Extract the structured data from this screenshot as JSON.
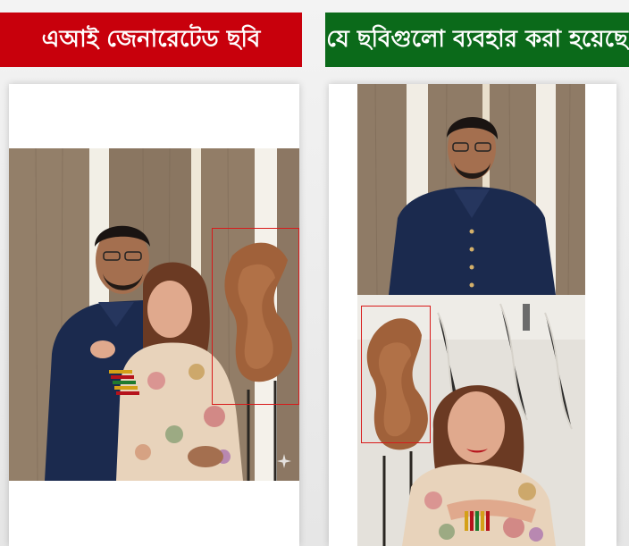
{
  "left_panel": {
    "title": "এআই জেনারেটেড ছবি",
    "title_bg": "#c8000c"
  },
  "right_panel": {
    "title": "যে ছবিগুলো ব্যবহার করা হয়েছে",
    "title_bg": "#0b6a1a"
  },
  "colors": {
    "highlight_box": "#d81a1a",
    "wood_wall": "#8f7a64",
    "navy_outfit": "#1b2a4e"
  },
  "icons": [
    "sparkle-icon"
  ]
}
